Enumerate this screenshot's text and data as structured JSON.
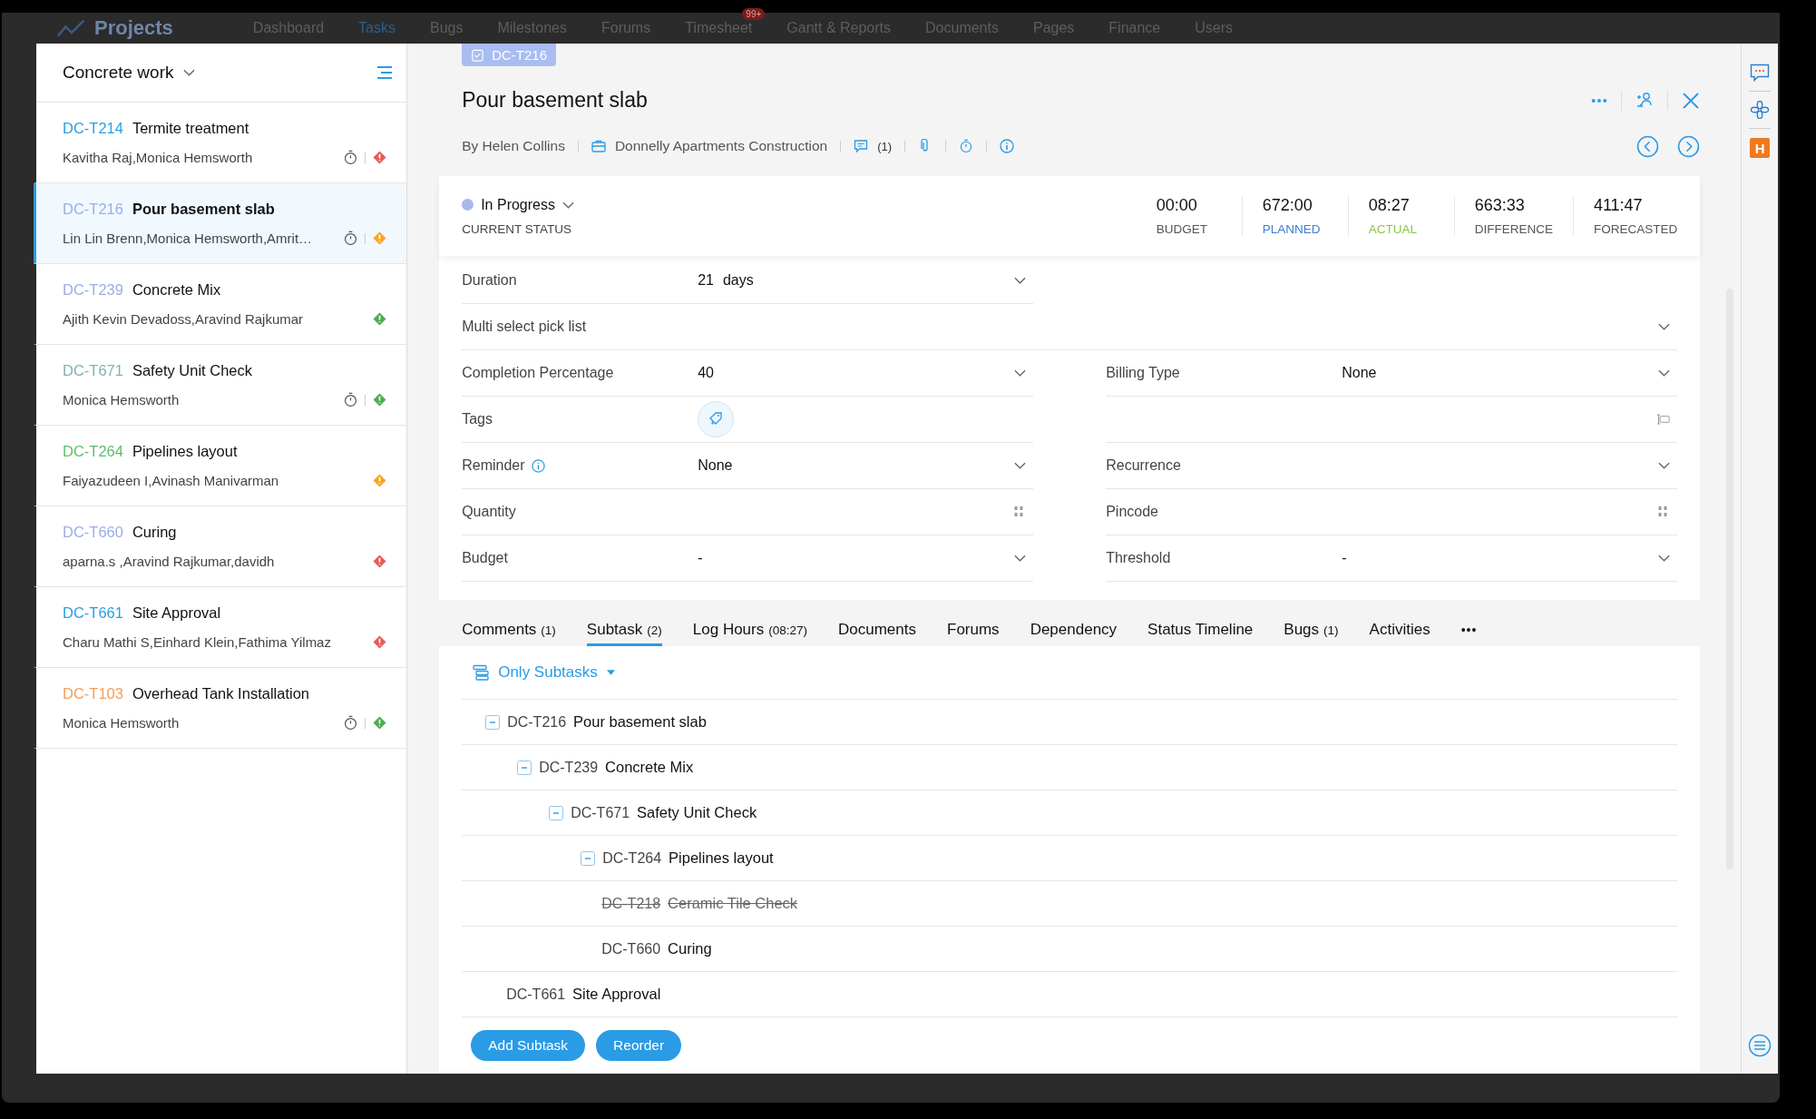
{
  "backdrop": {
    "app_name": "Projects",
    "nav": [
      {
        "label": "Dashboard",
        "selected": false
      },
      {
        "label": "Tasks",
        "selected": true
      },
      {
        "label": "Bugs",
        "selected": false
      },
      {
        "label": "Milestones",
        "selected": false
      },
      {
        "label": "Forums",
        "selected": false
      },
      {
        "label": "Timesheet",
        "selected": false,
        "badge": "99+"
      },
      {
        "label": "Gantt & Reports",
        "selected": false
      },
      {
        "label": "Documents",
        "selected": false
      },
      {
        "label": "Pages",
        "selected": false
      },
      {
        "label": "Finance",
        "selected": false
      },
      {
        "label": "Users",
        "selected": false
      }
    ]
  },
  "list": {
    "title": "Concrete work",
    "items": [
      {
        "key": "DC-T214",
        "color": "#27a0e5",
        "title": "Termite treatment",
        "owners": "Kavitha Raj,Monica Hemsworth",
        "timer": true,
        "priority": {
          "color": "#e85a5a"
        },
        "selected": false
      },
      {
        "key": "DC-T216",
        "color": "#9aaee6",
        "title": "Pour basement slab",
        "owners": "Lin Lin Brenn,Monica Hemsworth,Amrit…",
        "timer": true,
        "priority": {
          "color": "#f5a623"
        },
        "selected": true
      },
      {
        "key": "DC-T239",
        "color": "#9aaee6",
        "title": "Concrete Mix",
        "owners": "Ajith Kevin Devadoss,Aravind Rajkumar",
        "timer": false,
        "priority": {
          "color": "#4cae4f"
        },
        "selected": false
      },
      {
        "key": "DC-T671",
        "color": "#7fb3b0",
        "title": "Safety Unit Check",
        "owners": "Monica Hemsworth",
        "timer": true,
        "priority": {
          "color": "#4cae4f"
        },
        "selected": false
      },
      {
        "key": "DC-T264",
        "color": "#5cbf6a",
        "title": "Pipelines layout",
        "owners": "Faiyazudeen I,Avinash Manivarman",
        "timer": false,
        "priority": {
          "color": "#f5a623"
        },
        "selected": false
      },
      {
        "key": "DC-T660",
        "color": "#9aaee6",
        "title": "Curing",
        "owners": "aparna.s ,Aravind Rajkumar,davidh",
        "timer": false,
        "priority": {
          "color": "#e85a5a"
        },
        "selected": false
      },
      {
        "key": "DC-T661",
        "color": "#27a0e5",
        "title": "Site Approval",
        "owners": "Charu Mathi S,Einhard Klein,Fathima Yilmaz",
        "timer": false,
        "priority": {
          "color": "#e85a5a"
        },
        "selected": false
      },
      {
        "key": "DC-T103",
        "color": "#f39c5a",
        "title": "Overhead Tank Installation",
        "owners": "Monica Hemsworth",
        "timer": true,
        "priority": {
          "color": "#4cae4f"
        },
        "selected": false
      }
    ]
  },
  "detail": {
    "key": "DC-T216",
    "title": "Pour basement slab",
    "author": "By Helen Collins",
    "project": "Donnelly Apartments Construction",
    "comments": "(1)",
    "status": {
      "label": "In Progress",
      "color": "#a8b8ec",
      "caption": "CURRENT STATUS"
    },
    "metrics": [
      {
        "value": "00:00",
        "label": "BUDGET",
        "color": "#555555"
      },
      {
        "value": "672:00",
        "label": "PLANNED",
        "color": "#3b7fd6"
      },
      {
        "value": "08:27",
        "label": "ACTUAL",
        "color": "#8cc63f"
      },
      {
        "value": "663:33",
        "label": "DIFFERENCE",
        "color": "#555555"
      },
      {
        "value": "411:47",
        "label": "FORECASTED",
        "color": "#555555"
      }
    ],
    "fields": [
      {
        "full": false,
        "cells": [
          {
            "label": "Duration",
            "value": "21",
            "unit": "days",
            "kind": "dropdown"
          }
        ]
      },
      {
        "full": true,
        "cells": [
          {
            "label": "Multi select pick list",
            "kind": "dropdown"
          }
        ]
      },
      {
        "full": false,
        "cells": [
          {
            "label": "Completion Percentage",
            "value": "40",
            "kind": "dropdown"
          },
          {
            "label": "Billing Type",
            "value": "None",
            "kind": "dropdown"
          }
        ]
      },
      {
        "full": false,
        "cells": [
          {
            "label": "Tags",
            "kind": "tag"
          },
          {
            "kind": "textfield"
          }
        ]
      },
      {
        "full": false,
        "cells": [
          {
            "label": "Reminder",
            "info": true,
            "value": "None",
            "kind": "dropdown"
          },
          {
            "label": "Recurrence",
            "kind": "dropdown"
          }
        ]
      },
      {
        "full": false,
        "cells": [
          {
            "label": "Quantity",
            "kind": "number"
          },
          {
            "label": "Pincode",
            "kind": "number"
          }
        ]
      },
      {
        "full": false,
        "cells": [
          {
            "label": "Budget",
            "value": "-",
            "kind": "dropdown"
          },
          {
            "label": "Threshold",
            "value": "-",
            "kind": "dropdown"
          }
        ]
      }
    ],
    "tabs": [
      {
        "label": "Comments",
        "count": "(1)",
        "selected": false
      },
      {
        "label": "Subtask",
        "count": "(2)",
        "selected": true
      },
      {
        "label": "Log Hours",
        "count": "(08:27)",
        "selected": false
      },
      {
        "label": "Documents",
        "selected": false
      },
      {
        "label": "Forums",
        "selected": false
      },
      {
        "label": "Dependency",
        "selected": false
      },
      {
        "label": "Status Timeline",
        "selected": false
      },
      {
        "label": "Bugs",
        "count": "(1)",
        "selected": false
      },
      {
        "label": "Activities",
        "selected": false
      }
    ],
    "tabs_more": "•••",
    "subtasks": {
      "filter": "Only Subtasks",
      "tree": [
        {
          "key": "DC-T216",
          "title": "Pour basement slab",
          "expanded": true,
          "children": [
            {
              "key": "DC-T239",
              "title": "Concrete Mix",
              "expanded": true,
              "children": [
                {
                  "key": "DC-T671",
                  "title": "Safety Unit Check",
                  "expanded": true,
                  "children": [
                    {
                      "key": "DC-T264",
                      "title": "Pipelines layout",
                      "expanded": true,
                      "children": [
                        {
                          "key": "DC-T218",
                          "title": "Ceramic Tile Check",
                          "done": true
                        },
                        {
                          "key": "DC-T660",
                          "title": "Curing",
                          "done": false
                        }
                      ]
                    }
                  ]
                }
              ]
            },
            {
              "key": "DC-T661",
              "title": "Site Approval",
              "done": false
            }
          ]
        }
      ],
      "buttons": [
        "Add Subtask",
        "Reorder"
      ]
    }
  },
  "rail": {
    "badge": "H"
  }
}
